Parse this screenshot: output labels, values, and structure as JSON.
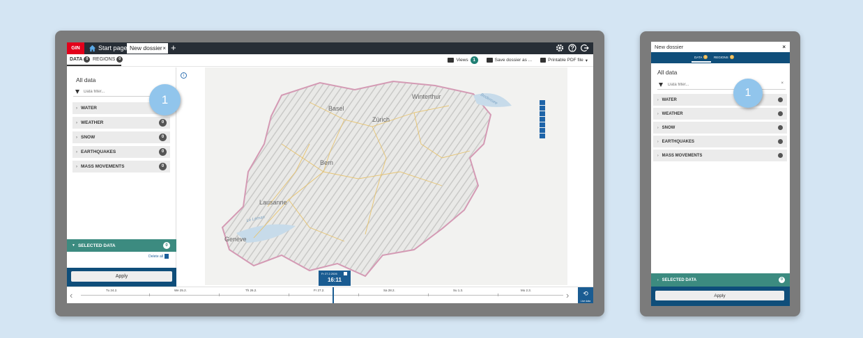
{
  "desktop": {
    "topbar": {
      "logo": "GIN",
      "start_tab": "Start page",
      "dossier_tab": "New dossier",
      "close_glyph": "×",
      "add_glyph": "+",
      "icons": [
        "gear-icon",
        "help-icon",
        "logout-icon"
      ]
    },
    "tabs": {
      "data_label": "DATA",
      "data_count": "0",
      "regions_label": "REGIONS",
      "regions_count": "0"
    },
    "toolbar": {
      "views_label": "Views",
      "views_count": "1",
      "save_label": "Save dossier as ...",
      "print_label": "Printable PDF file",
      "print_caret": "▾"
    },
    "panel": {
      "title": "All data",
      "filter_placeholder": "Data filter...",
      "categories": [
        {
          "label": "WATER",
          "count": ""
        },
        {
          "label": "WEATHER",
          "count": "0"
        },
        {
          "label": "SNOW",
          "count": "0"
        },
        {
          "label": "EARTHQUAKES",
          "count": "0"
        },
        {
          "label": "MASS MOVEMENTS",
          "count": "0"
        }
      ],
      "marker": "1",
      "selected_label": "SELECTED DATA",
      "selected_count": "0",
      "delete_all": "Delete all",
      "apply": "Apply"
    },
    "map": {
      "info_glyph": "i",
      "cities": [
        "Basel",
        "Winterthur",
        "Zürich",
        "Bern",
        "Lausanne",
        "Genève",
        "Le Léman",
        "Bodensee"
      ]
    },
    "timeline": {
      "date": "Fr 27.2.2026",
      "time": "16:11",
      "now_label": "Live data",
      "labels": [
        "Tu 24.2.",
        "We 25.2.",
        "Th 26.2.",
        "Fr 27.2.",
        "Sa 28.2.",
        "Su 1.3.",
        "Mo 2.3."
      ],
      "prev": "‹",
      "next": "›"
    }
  },
  "mobile": {
    "title": "New dossier",
    "close": "×",
    "data_label": "DATA",
    "data_count": "0",
    "regions_label": "REGIONS",
    "regions_count": "0",
    "panel_title": "All data",
    "filter_placeholder": "Data filter...",
    "filter_clear": "×",
    "categories": [
      "WATER",
      "WEATHER",
      "SNOW",
      "EARTHQUAKES",
      "MASS MOVEMENTS"
    ],
    "marker": "1",
    "selected_label": "SELECTED DATA",
    "selected_count": "0",
    "apply": "Apply"
  },
  "colors": {
    "page_bg": "#d4e5f3",
    "frame": "#7b7b7b",
    "topbar": "#272e36",
    "brand_red": "#e3001b",
    "teal": "#3c8b80",
    "navy": "#0f4e7a",
    "marker": "#91c5ec"
  }
}
